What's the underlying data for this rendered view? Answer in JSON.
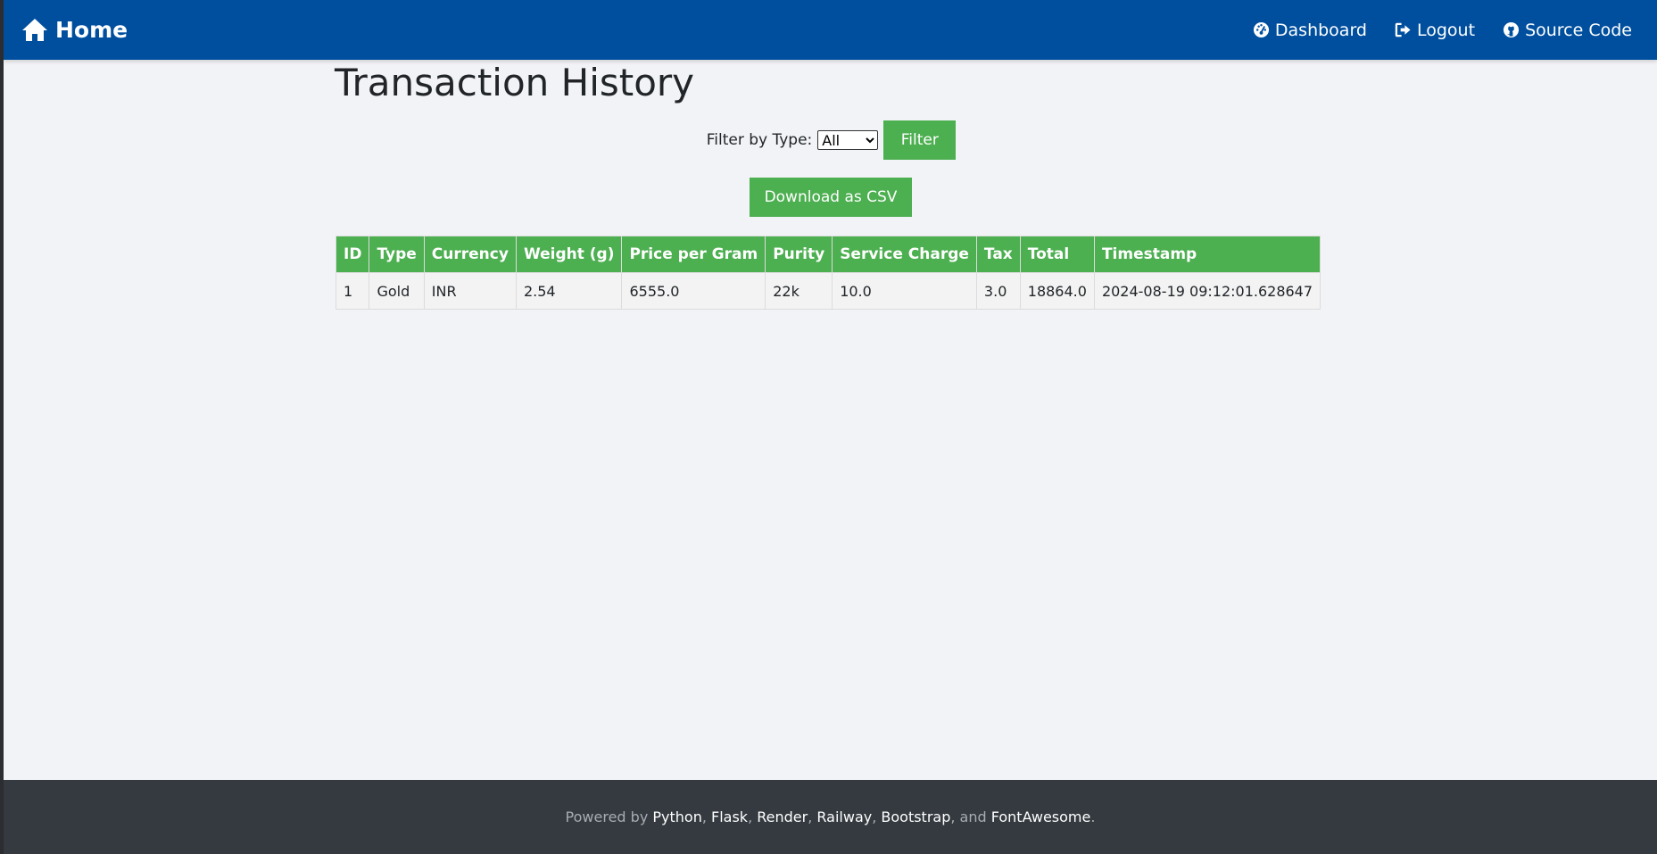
{
  "navbar": {
    "brand": {
      "label": "Home",
      "icon": "home-icon"
    },
    "links": [
      {
        "label": "Dashboard",
        "icon": "dashboard-icon"
      },
      {
        "label": "Logout",
        "icon": "logout-icon"
      },
      {
        "label": "Source Code",
        "icon": "github-icon"
      }
    ],
    "color": "#004f9e"
  },
  "main": {
    "title": "Transaction History",
    "filter": {
      "label": "Filter by Type:",
      "selected": "All",
      "button_label": "Filter"
    },
    "download_label": "Download as CSV",
    "accent_color": "#4caf50"
  },
  "table": {
    "headers": [
      "ID",
      "Type",
      "Currency",
      "Weight (g)",
      "Price per Gram",
      "Purity",
      "Service Charge",
      "Tax",
      "Total",
      "Timestamp"
    ],
    "rows": [
      [
        "1",
        "Gold",
        "INR",
        "2.54",
        "6555.0",
        "22k",
        "10.0",
        "3.0",
        "18864.0",
        "2024-08-19 09:12:01.628647"
      ]
    ]
  },
  "footer": {
    "prefix": "Powered by ",
    "items": [
      "Python",
      "Flask",
      "Render",
      "Railway",
      "Bootstrap",
      "FontAwesome"
    ],
    "sep": ", ",
    "and": ", and ",
    "suffix": "."
  }
}
